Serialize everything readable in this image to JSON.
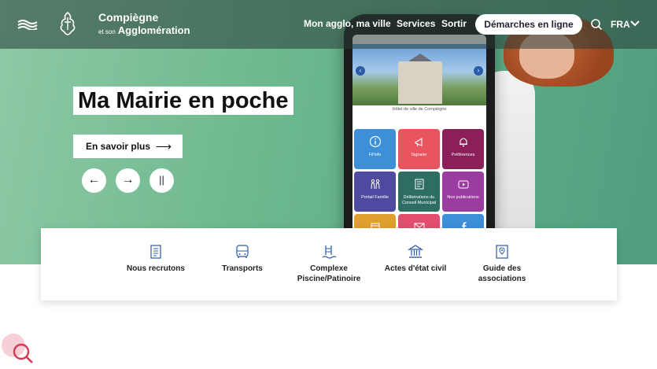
{
  "header": {
    "brand_title": "Compiègne",
    "brand_sub_small": "et son",
    "brand_sub": "Agglomération",
    "nav": [
      "Mon agglo, ma ville",
      "Services",
      "Sortir"
    ],
    "cta_label": "Démarches en ligne",
    "lang": "FRA"
  },
  "hero": {
    "title": "Ma Mairie en poche",
    "cta_label": "En savoir plus",
    "cta_arrow": "⟶",
    "controls": {
      "prev": "←",
      "next": "→",
      "pause": "||"
    }
  },
  "phone": {
    "caption": "Hôtel de ville de Compiègne",
    "tiles": [
      {
        "label": "Fil'info",
        "color": "#3d8fd8"
      },
      {
        "label": "Signaler",
        "color": "#e8555e"
      },
      {
        "label": "Préférences",
        "color": "#8a1f5a"
      },
      {
        "label": "Portail Famille",
        "color": "#4e4aa0"
      },
      {
        "label": "Délibérations du Conseil Municipal",
        "color": "#2e6e62"
      },
      {
        "label": "Nos publications",
        "color": "#9a3ca0"
      },
      {
        "label": "",
        "color": "#e0a030"
      },
      {
        "label": "",
        "color": "#e24e6f"
      },
      {
        "label": "",
        "color": "#3d8fd8"
      }
    ]
  },
  "quick_links": [
    {
      "label": "Nous recrutons"
    },
    {
      "label": "Transports"
    },
    {
      "label": "Complexe Piscine/Patinoire"
    },
    {
      "label": "Actes d'état civil"
    },
    {
      "label": "Guide des associations"
    }
  ],
  "colors": {
    "accent": "#2a5ba8",
    "hero_green": "#6db88f",
    "search_accent": "#d63b52"
  }
}
